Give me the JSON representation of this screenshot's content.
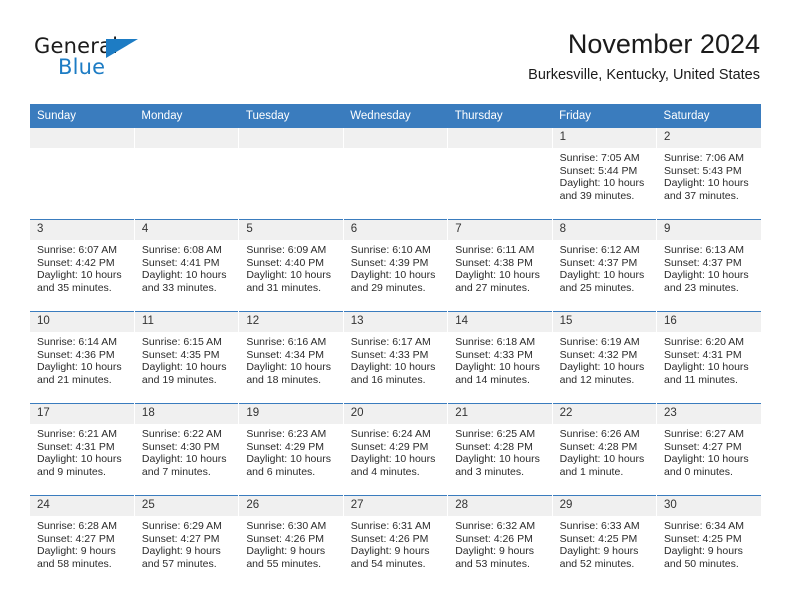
{
  "brand": {
    "name_part1": "General",
    "name_part2": "Blue",
    "flag_icon": "triangle-flag-icon"
  },
  "header": {
    "title": "November 2024",
    "location": "Burkesville, Kentucky, United States"
  },
  "calendar": {
    "weekday_headers": [
      "Sunday",
      "Monday",
      "Tuesday",
      "Wednesday",
      "Thursday",
      "Friday",
      "Saturday"
    ],
    "accent_color": "#3a7cbe",
    "daynum_band_color": "#f0f0f0",
    "weeks": [
      [
        {
          "day": "",
          "empty": true
        },
        {
          "day": "",
          "empty": true
        },
        {
          "day": "",
          "empty": true
        },
        {
          "day": "",
          "empty": true
        },
        {
          "day": "",
          "empty": true
        },
        {
          "day": "1",
          "sunrise": "Sunrise: 7:05 AM",
          "sunset": "Sunset: 5:44 PM",
          "daylight": "Daylight: 10 hours and 39 minutes."
        },
        {
          "day": "2",
          "sunrise": "Sunrise: 7:06 AM",
          "sunset": "Sunset: 5:43 PM",
          "daylight": "Daylight: 10 hours and 37 minutes."
        }
      ],
      [
        {
          "day": "3",
          "sunrise": "Sunrise: 6:07 AM",
          "sunset": "Sunset: 4:42 PM",
          "daylight": "Daylight: 10 hours and 35 minutes."
        },
        {
          "day": "4",
          "sunrise": "Sunrise: 6:08 AM",
          "sunset": "Sunset: 4:41 PM",
          "daylight": "Daylight: 10 hours and 33 minutes."
        },
        {
          "day": "5",
          "sunrise": "Sunrise: 6:09 AM",
          "sunset": "Sunset: 4:40 PM",
          "daylight": "Daylight: 10 hours and 31 minutes."
        },
        {
          "day": "6",
          "sunrise": "Sunrise: 6:10 AM",
          "sunset": "Sunset: 4:39 PM",
          "daylight": "Daylight: 10 hours and 29 minutes."
        },
        {
          "day": "7",
          "sunrise": "Sunrise: 6:11 AM",
          "sunset": "Sunset: 4:38 PM",
          "daylight": "Daylight: 10 hours and 27 minutes."
        },
        {
          "day": "8",
          "sunrise": "Sunrise: 6:12 AM",
          "sunset": "Sunset: 4:37 PM",
          "daylight": "Daylight: 10 hours and 25 minutes."
        },
        {
          "day": "9",
          "sunrise": "Sunrise: 6:13 AM",
          "sunset": "Sunset: 4:37 PM",
          "daylight": "Daylight: 10 hours and 23 minutes."
        }
      ],
      [
        {
          "day": "10",
          "sunrise": "Sunrise: 6:14 AM",
          "sunset": "Sunset: 4:36 PM",
          "daylight": "Daylight: 10 hours and 21 minutes."
        },
        {
          "day": "11",
          "sunrise": "Sunrise: 6:15 AM",
          "sunset": "Sunset: 4:35 PM",
          "daylight": "Daylight: 10 hours and 19 minutes."
        },
        {
          "day": "12",
          "sunrise": "Sunrise: 6:16 AM",
          "sunset": "Sunset: 4:34 PM",
          "daylight": "Daylight: 10 hours and 18 minutes."
        },
        {
          "day": "13",
          "sunrise": "Sunrise: 6:17 AM",
          "sunset": "Sunset: 4:33 PM",
          "daylight": "Daylight: 10 hours and 16 minutes."
        },
        {
          "day": "14",
          "sunrise": "Sunrise: 6:18 AM",
          "sunset": "Sunset: 4:33 PM",
          "daylight": "Daylight: 10 hours and 14 minutes."
        },
        {
          "day": "15",
          "sunrise": "Sunrise: 6:19 AM",
          "sunset": "Sunset: 4:32 PM",
          "daylight": "Daylight: 10 hours and 12 minutes."
        },
        {
          "day": "16",
          "sunrise": "Sunrise: 6:20 AM",
          "sunset": "Sunset: 4:31 PM",
          "daylight": "Daylight: 10 hours and 11 minutes."
        }
      ],
      [
        {
          "day": "17",
          "sunrise": "Sunrise: 6:21 AM",
          "sunset": "Sunset: 4:31 PM",
          "daylight": "Daylight: 10 hours and 9 minutes."
        },
        {
          "day": "18",
          "sunrise": "Sunrise: 6:22 AM",
          "sunset": "Sunset: 4:30 PM",
          "daylight": "Daylight: 10 hours and 7 minutes."
        },
        {
          "day": "19",
          "sunrise": "Sunrise: 6:23 AM",
          "sunset": "Sunset: 4:29 PM",
          "daylight": "Daylight: 10 hours and 6 minutes."
        },
        {
          "day": "20",
          "sunrise": "Sunrise: 6:24 AM",
          "sunset": "Sunset: 4:29 PM",
          "daylight": "Daylight: 10 hours and 4 minutes."
        },
        {
          "day": "21",
          "sunrise": "Sunrise: 6:25 AM",
          "sunset": "Sunset: 4:28 PM",
          "daylight": "Daylight: 10 hours and 3 minutes."
        },
        {
          "day": "22",
          "sunrise": "Sunrise: 6:26 AM",
          "sunset": "Sunset: 4:28 PM",
          "daylight": "Daylight: 10 hours and 1 minute."
        },
        {
          "day": "23",
          "sunrise": "Sunrise: 6:27 AM",
          "sunset": "Sunset: 4:27 PM",
          "daylight": "Daylight: 10 hours and 0 minutes."
        }
      ],
      [
        {
          "day": "24",
          "sunrise": "Sunrise: 6:28 AM",
          "sunset": "Sunset: 4:27 PM",
          "daylight": "Daylight: 9 hours and 58 minutes."
        },
        {
          "day": "25",
          "sunrise": "Sunrise: 6:29 AM",
          "sunset": "Sunset: 4:27 PM",
          "daylight": "Daylight: 9 hours and 57 minutes."
        },
        {
          "day": "26",
          "sunrise": "Sunrise: 6:30 AM",
          "sunset": "Sunset: 4:26 PM",
          "daylight": "Daylight: 9 hours and 55 minutes."
        },
        {
          "day": "27",
          "sunrise": "Sunrise: 6:31 AM",
          "sunset": "Sunset: 4:26 PM",
          "daylight": "Daylight: 9 hours and 54 minutes."
        },
        {
          "day": "28",
          "sunrise": "Sunrise: 6:32 AM",
          "sunset": "Sunset: 4:26 PM",
          "daylight": "Daylight: 9 hours and 53 minutes."
        },
        {
          "day": "29",
          "sunrise": "Sunrise: 6:33 AM",
          "sunset": "Sunset: 4:25 PM",
          "daylight": "Daylight: 9 hours and 52 minutes."
        },
        {
          "day": "30",
          "sunrise": "Sunrise: 6:34 AM",
          "sunset": "Sunset: 4:25 PM",
          "daylight": "Daylight: 9 hours and 50 minutes."
        }
      ]
    ]
  }
}
